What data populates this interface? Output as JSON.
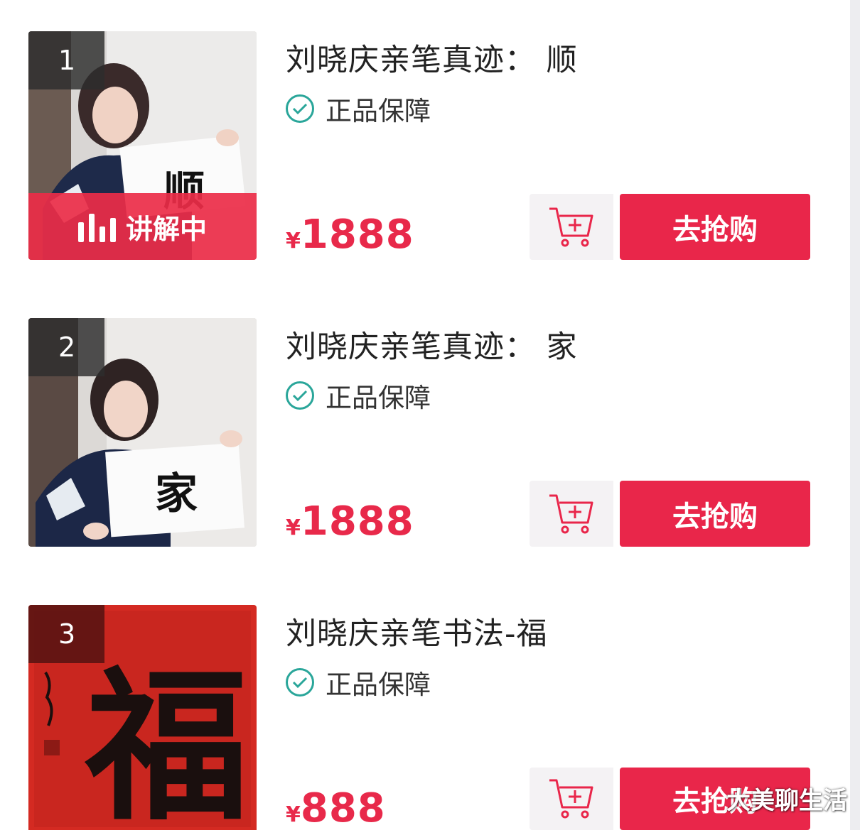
{
  "colors": {
    "accent": "#e9264a",
    "check": "#2aa69a"
  },
  "products": [
    {
      "rank": "1",
      "title": "刘晓庆亲笔真迹：  顺",
      "guarantee": "正品保障",
      "yen": "¥",
      "price": "1888",
      "live_label": "讲解中",
      "buy_label": "去抢购",
      "cart_icon": "cart-add-icon"
    },
    {
      "rank": "2",
      "title": "刘晓庆亲笔真迹：  家",
      "guarantee": "正品保障",
      "yen": "¥",
      "price": "1888",
      "buy_label": "去抢购",
      "cart_icon": "cart-add-icon"
    },
    {
      "rank": "3",
      "title": "刘晓庆亲笔书法-福",
      "guarantee": "正品保障",
      "yen": "¥",
      "price": "888",
      "buy_label": "去抢购",
      "cart_icon": "cart-add-icon"
    }
  ],
  "watermark": "大美聊生活",
  "artwork": {
    "card1": "顺",
    "card2": "家",
    "card3": "福"
  }
}
